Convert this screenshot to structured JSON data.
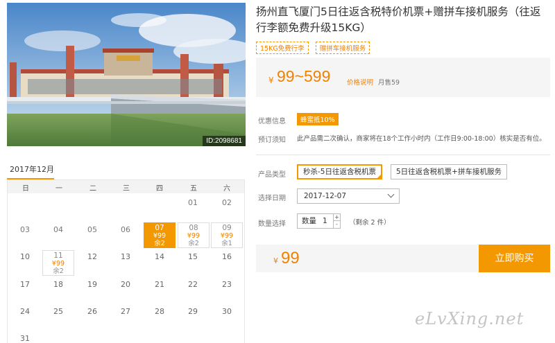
{
  "photo": {
    "id_label": "ID:2098681",
    "alt_icon": "airport-terminal-photo"
  },
  "calendar": {
    "month_label": "2017年12月",
    "weekdays": [
      "日",
      "一",
      "二",
      "三",
      "四",
      "五",
      "六"
    ],
    "plain_days": [
      "01",
      "02",
      "03",
      "04",
      "05",
      "06",
      "10",
      "12",
      "13",
      "14",
      "15",
      "16",
      "17",
      "18",
      "19",
      "20",
      "21",
      "22",
      "23",
      "24",
      "25",
      "26",
      "27",
      "28",
      "29",
      "30",
      "31"
    ],
    "price_cells": [
      {
        "day": "07",
        "price": "¥99",
        "stock": "余2",
        "selected": true
      },
      {
        "day": "08",
        "price": "¥99",
        "stock": "余2",
        "selected": false
      },
      {
        "day": "09",
        "price": "¥99",
        "stock": "余1",
        "selected": false
      },
      {
        "day": "11",
        "price": "¥99",
        "stock": "余2",
        "selected": false
      }
    ]
  },
  "product": {
    "title": "扬州直飞厦门5日往返含税特价机票+赠拼车接机服务（往返行李额免费升级15KG）",
    "tags": [
      "15KG免费行李",
      "赠拼车接机服务"
    ],
    "price": {
      "currency": "¥",
      "range": "99~599",
      "note": "价格说明",
      "sold": "月售59"
    }
  },
  "promo": {
    "label": "优惠信息",
    "badge": "蜂蜜抵10%"
  },
  "booking_notice": {
    "label": "预订须知",
    "text": "此产品需二次确认，商家将在18个工作小时内（工作日9:00-18:00）核实是否有位。"
  },
  "product_type": {
    "label": "产品类型",
    "options": [
      "秒杀-5日往返含税机票",
      "5日往返含税机票+拼车接机服务"
    ],
    "selected_index": 0
  },
  "date_select": {
    "label": "选择日期",
    "value": "2017-12-07"
  },
  "quantity": {
    "label": "数量选择",
    "prefix": "数量",
    "value": "1",
    "plus": "+",
    "minus": "-",
    "remain": "（剩余 2 件）"
  },
  "total": {
    "currency": "¥",
    "value": "99"
  },
  "buy_button": {
    "label": "立即购买"
  },
  "watermark": "eLvXing.net",
  "colors": {
    "accent": "#f39800",
    "price": "#f08200"
  }
}
